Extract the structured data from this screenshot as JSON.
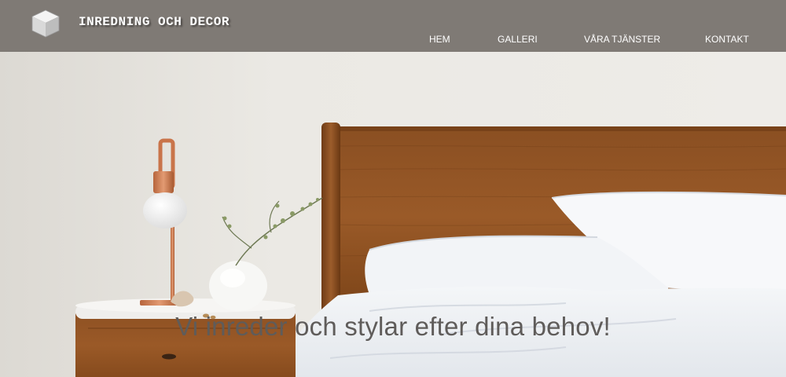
{
  "header": {
    "logo_icon": "cube-icon",
    "title": "INREDNING OCH DECOR",
    "background": "#7f7a75"
  },
  "nav": {
    "items": [
      {
        "label": "HEM"
      },
      {
        "label": "GALLERI"
      },
      {
        "label": "VÅRA TJÄNSTER"
      },
      {
        "label": "KONTAKT"
      }
    ]
  },
  "hero": {
    "tagline": "Vi inreder och stylar efter dina behov!",
    "tagline_color": "#5f5c5a"
  }
}
